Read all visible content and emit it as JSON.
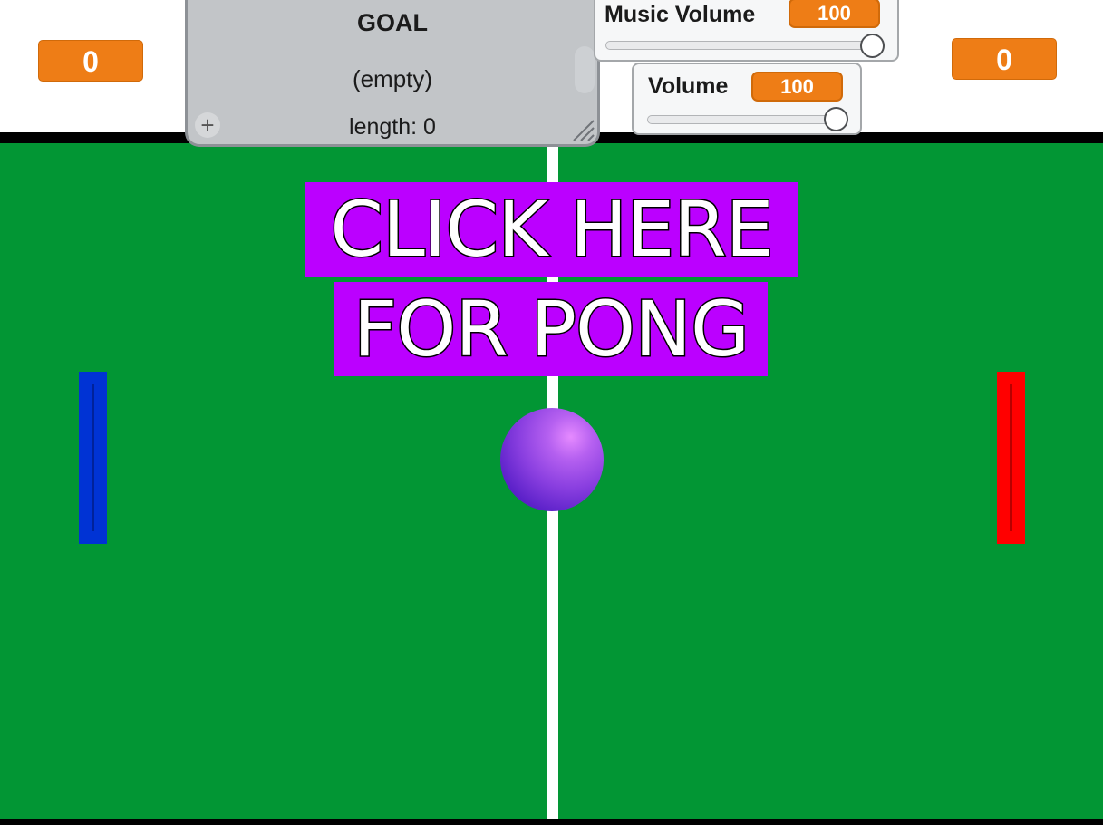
{
  "scores": {
    "left": "0",
    "right": "0"
  },
  "goal_list": {
    "title": "GOAL",
    "empty_text": "(empty)",
    "length_text": "length: 0"
  },
  "music_volume": {
    "label": "Music Volume",
    "value": "100",
    "level": 100
  },
  "volume": {
    "label": "Volume",
    "value": "100",
    "level": 100
  },
  "banner": {
    "line1": "CLICK HERE",
    "line2": "FOR PONG"
  },
  "colors": {
    "field": "#029634",
    "banner": "#bb00ff",
    "score": "#ee7d16",
    "paddle_left": "#0033d4",
    "paddle_right": "#ff0000",
    "ball": "#8a3fe0"
  },
  "icons": {
    "add": "plus-icon",
    "resize": "resize-handle-icon"
  }
}
